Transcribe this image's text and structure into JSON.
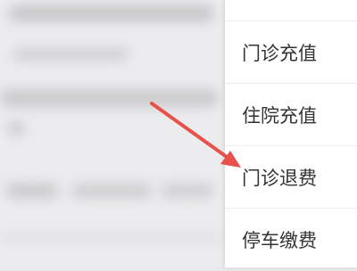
{
  "menu": {
    "items": [
      {
        "label": ""
      },
      {
        "label": "门诊充值"
      },
      {
        "label": "住院充值"
      },
      {
        "label": "门诊退费"
      },
      {
        "label": "停车缴费"
      }
    ]
  },
  "colors": {
    "arrow": "#e8514b",
    "menu_background": "#ffffff",
    "menu_text": "#333333",
    "divider": "#ededed"
  },
  "icons": {
    "annotation": "arrow-pointer"
  }
}
